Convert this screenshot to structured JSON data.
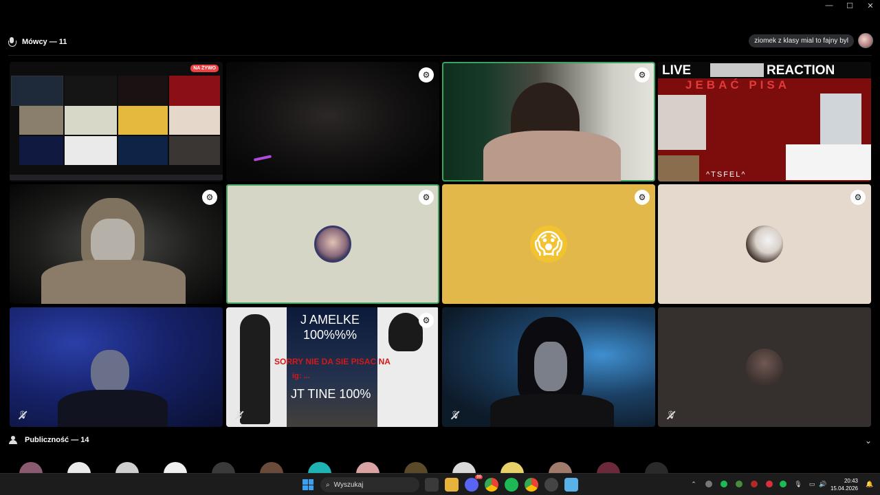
{
  "window": {
    "controls": [
      "minimize",
      "maximize",
      "close"
    ]
  },
  "stage": {
    "speakers_label": "Mówcy — 11",
    "status_text": "ziomek z klasy mial to fajny byl"
  },
  "tiles": [
    {
      "name": "screen-share",
      "live_label": "NA ŻYWO"
    },
    {
      "name": "webcam-dark"
    },
    {
      "name": "webcam-girl"
    },
    {
      "name": "live-reaction",
      "title_left": "LIVE",
      "title_right": "REACTION",
      "subtitle": "JEBAĆ PISA",
      "footer": "^TSFEL^"
    },
    {
      "name": "webcam-hood"
    },
    {
      "name": "avatar-beige"
    },
    {
      "name": "avatar-emoji",
      "emoji": "😱"
    },
    {
      "name": "avatar-cream"
    },
    {
      "name": "webcam-blue"
    },
    {
      "name": "manga-promo",
      "line1": "J AMELKE",
      "line2": "100%%%",
      "line3": "SORRY NIE DA SIE PISAC NA",
      "line4": "ig: ...",
      "line5": "JT TINE 100%"
    },
    {
      "name": "webcam-longhair"
    },
    {
      "name": "avatar-dark"
    }
  ],
  "audience": {
    "label": "Publiczność — 14"
  },
  "taskbar": {
    "search_placeholder": "Wyszukaj",
    "time": "20:43",
    "date": "15.04.2026",
    "discord_badge": "99"
  }
}
